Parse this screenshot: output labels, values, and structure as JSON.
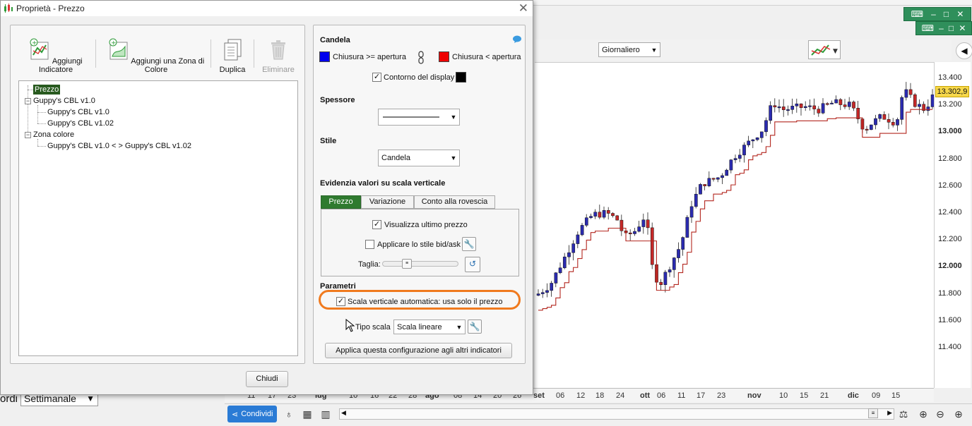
{
  "dialog": {
    "title": "Proprietà - Prezzo",
    "toolbar": {
      "add_indicator": "Aggiungi Indicatore",
      "add_color_zone": "Aggiungi una Zona di Colore",
      "duplicate": "Duplica",
      "delete": "Eliminare"
    },
    "tree": {
      "root": "Prezzo",
      "nodes": [
        {
          "label": "Guppy's CBL v1.0"
        },
        {
          "label": "Guppy's CBL v1.0"
        },
        {
          "label": "Guppy's CBL v1.02"
        },
        {
          "label": "Zona colore"
        },
        {
          "label": "Guppy's CBL v1.0 < > Guppy's CBL v1.02"
        }
      ]
    },
    "candle": {
      "title": "Candela",
      "up_label": "Chiusura >= apertura",
      "down_label": "Chiusura < apertura",
      "up_color": "#0000ee",
      "down_color": "#ee0000",
      "outline_label": "Contorno del display",
      "outline_checked": true,
      "outline_color": "#000000"
    },
    "thickness": {
      "title": "Spessore"
    },
    "style": {
      "title": "Stile",
      "value": "Candela"
    },
    "highlight": {
      "title": "Evidenzia valori su scala verticale",
      "tabs": [
        "Prezzo",
        "Variazione",
        "Conto alla rovescia"
      ],
      "active_tab": "Prezzo",
      "show_last_price": "Visualizza ultimo prezzo",
      "show_last_price_checked": true,
      "bid_ask": "Applicare lo stile bid/ask",
      "bid_ask_checked": false,
      "size_label": "Taglia:"
    },
    "params": {
      "title": "Parametri",
      "auto_scale": "Scala verticale automatica: usa solo il prezzo",
      "auto_scale_checked": true,
      "scale_type_label": "Tipo scala",
      "scale_type_value": "Scala lineare",
      "apply_all": "Applica questa configurazione agli altri indicatori"
    },
    "close_button": "Chiudi"
  },
  "chart": {
    "period": "Giornaliero",
    "last_price": "13.302,9",
    "y_ticks": [
      "13.400",
      "13.200",
      "13.000",
      "12.800",
      "12.600",
      "12.400",
      "12.200",
      "12.000",
      "11.800",
      "11.600",
      "11.400"
    ],
    "y_ticks_bold": [
      "13.000",
      "12.000"
    ],
    "x_ticks": [
      "11",
      "17",
      "23",
      "lug",
      "10",
      "16",
      "22",
      "28",
      "ago",
      "08",
      "14",
      "20",
      "26",
      "set",
      "06",
      "12",
      "18",
      "24",
      "ott",
      "06",
      "11",
      "17",
      "23",
      "nov",
      "10",
      "15",
      "21",
      "dic",
      "09",
      "15"
    ],
    "x_ticks_bold": [
      "lug",
      "ago",
      "set",
      "ott",
      "nov",
      "dic"
    ]
  },
  "bottom": {
    "share": "Condividi",
    "left_label": "ordi",
    "left_combo": "Settimanale"
  },
  "colors": {
    "up": "#2b2bb0",
    "down": "#c62828",
    "signal_line": "#b3261e",
    "accent_green": "#2f7a2f",
    "highlight_ring": "#f07a1e"
  }
}
